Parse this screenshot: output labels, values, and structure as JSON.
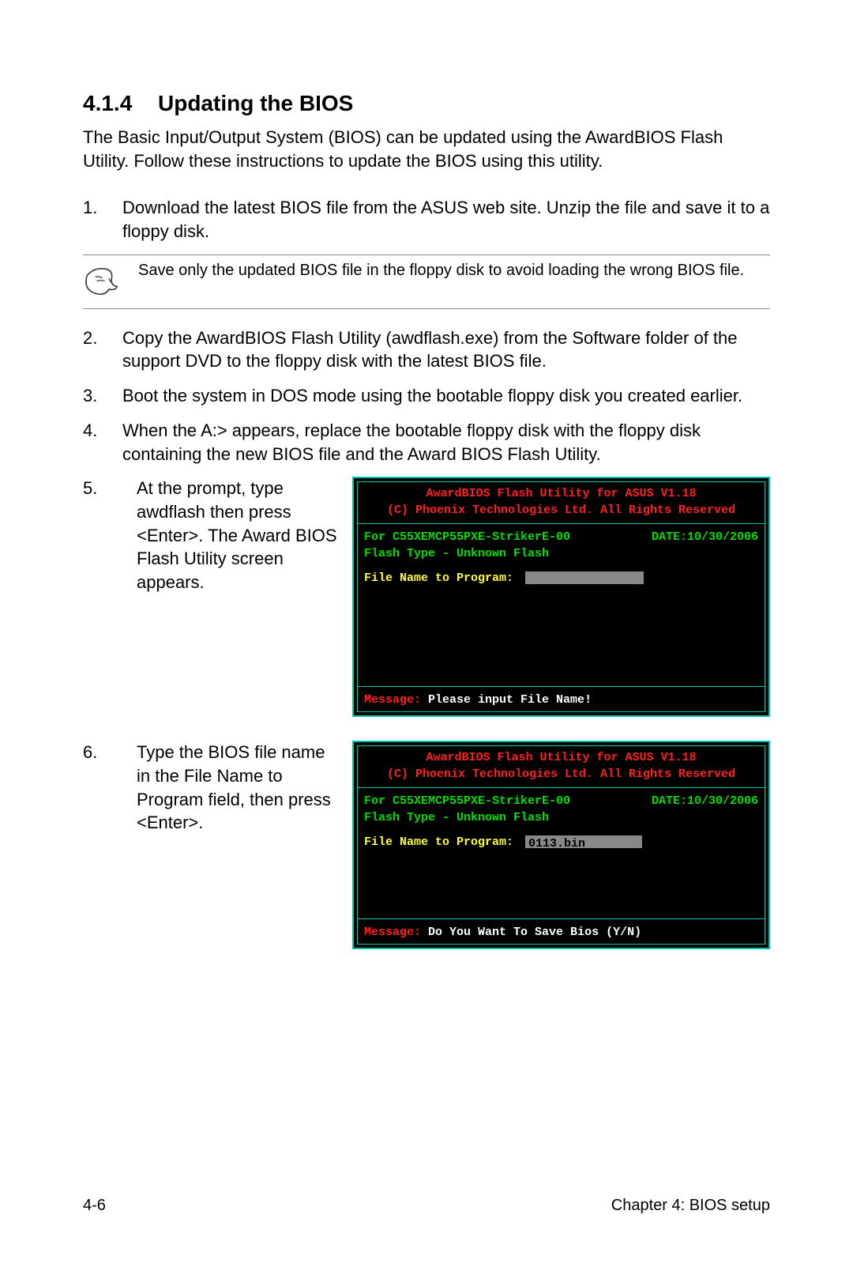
{
  "heading": {
    "number": "4.1.4",
    "title": "Updating the BIOS"
  },
  "intro": "The Basic Input/Output System (BIOS) can be updated using the AwardBIOS Flash Utility. Follow these instructions to update the BIOS using this utility.",
  "steps": {
    "s1": {
      "n": "1.",
      "t": "Download the latest BIOS file from the ASUS web site. Unzip the file and save it to a floppy disk."
    },
    "s2": {
      "n": "2.",
      "t": "Copy the AwardBIOS Flash Utility (awdflash.exe) from the Software folder of the support DVD to the floppy disk with the latest BIOS file."
    },
    "s3": {
      "n": "3.",
      "t": "Boot the system in DOS mode using the bootable floppy disk you created earlier."
    },
    "s4": {
      "n": "4.",
      "t": "When the A:> appears, replace the bootable floppy disk with the floppy disk containing the new BIOS file and the Award BIOS Flash Utility."
    },
    "s5": {
      "n": "5.",
      "t": "At the prompt, type awdflash then press <Enter>. The Award BIOS Flash Utility screen appears."
    },
    "s6": {
      "n": "6.",
      "t": "Type the BIOS file name in the File Name to Program field, then press <Enter>."
    }
  },
  "note": "Save only the updated BIOS file in the floppy disk to avoid loading the wrong BIOS file.",
  "term": {
    "title": "AwardBIOS Flash Utility for ASUS V1.18",
    "copyright": "(C) Phoenix Technologies Ltd. All Rights Reserved",
    "board": "For C55XEMCP55PXE-StrikerE-00",
    "date": "DATE:10/30/2006",
    "flash": "Flash Type - Unknown Flash",
    "prompt": "File Name to Program:",
    "msgLabel": "Message:",
    "msg1": "Please input File Name!",
    "fileValue": "0113.bin",
    "msg2": "Do You Want To Save Bios (Y/N)"
  },
  "footer": {
    "left": "4-6",
    "right": "Chapter 4: BIOS setup"
  }
}
